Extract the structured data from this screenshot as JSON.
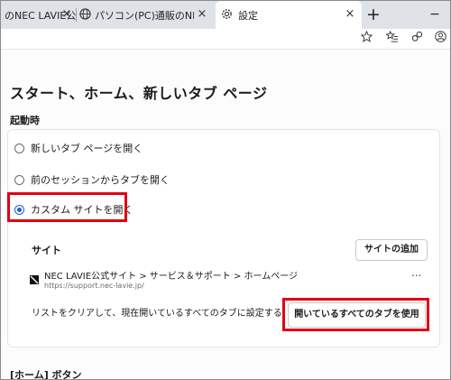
{
  "tabs": [
    {
      "title": "のNEC LAVIE公",
      "active": false
    },
    {
      "title": "パソコン(PC)通販のNEC LAVIE公",
      "active": false
    },
    {
      "title": "設定",
      "active": true
    }
  ],
  "icons": {
    "tab_close": "×",
    "new_tab": "+",
    "minimize": "−",
    "globe": "globe-icon",
    "gear": "gear-icon",
    "favorite": "star-icon",
    "favorites_list": "favorites-list-icon",
    "extensions": "extensions-icon",
    "profile": "profile-icon",
    "more": "..."
  },
  "settings": {
    "page_title": "スタート、ホーム、新しいタブ ページ",
    "startup_label": "起動時",
    "options": [
      {
        "label": "新しいタブ ページを開く",
        "checked": false
      },
      {
        "label": "前のセッションからタブを開く",
        "checked": false
      },
      {
        "label": "カスタム サイトを開く",
        "checked": true
      }
    ],
    "sites_label": "サイト",
    "add_site_button": "サイトの追加",
    "site": {
      "name": "NEC LAVIE公式サイト > サービス＆サポート > ホームページ",
      "url": "https://support.nec-lavie.jp/"
    },
    "clear_text": "リストをクリアして、現在開いているすべてのタブに設定する",
    "use_open_tabs_button": "開いているすべてのタブを使用",
    "home_button_label": "[ホーム] ボタン"
  },
  "colors": {
    "highlight": "#e00012",
    "radio_accent": "#1a5fd6"
  }
}
